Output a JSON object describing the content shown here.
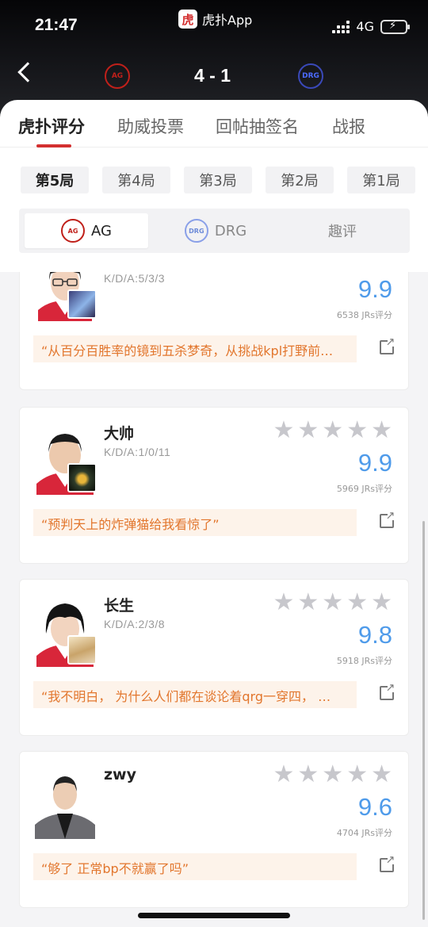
{
  "status": {
    "time": "21:47",
    "app_name": "虎扑App",
    "app_logo": "虎",
    "network": "4G"
  },
  "header": {
    "score": "4 - 1",
    "home_logo": "AG",
    "away_logo": "DRG"
  },
  "tabs": [
    "虎扑评分",
    "助威投票",
    "回帖抽签名",
    "战报"
  ],
  "rounds": [
    "第5局",
    "第4局",
    "第3局",
    "第2局",
    "第1局"
  ],
  "team_tabs": {
    "ag": "AG",
    "drg": "DRG",
    "fun": "趣评"
  },
  "players": [
    {
      "name": "",
      "kda": "K/D/A:5/3/3",
      "rating": "9.9",
      "count": "6538 JRs评分",
      "comment": "“从百分百胜率的镜到五杀梦奇，从挑战kpl打野前…"
    },
    {
      "name": "大帅",
      "kda": "K/D/A:1/0/11",
      "rating": "9.9",
      "count": "5969 JRs评分",
      "comment": "“预判天上的炸弹猫给我看惊了”"
    },
    {
      "name": "长生",
      "kda": "K/D/A:2/3/8",
      "rating": "9.8",
      "count": "5918 JRs评分",
      "comment": "“我不明白， 为什么人们都在谈论着qrg一穿四， …"
    },
    {
      "name": "zwy",
      "kda": "",
      "rating": "9.6",
      "count": "4704 JRs评分",
      "comment": "“够了 正常bp不就赢了吗”"
    }
  ],
  "colors": {
    "accent": "#d32f2f",
    "rating": "#4f9bea",
    "comment": "#e2762d"
  }
}
